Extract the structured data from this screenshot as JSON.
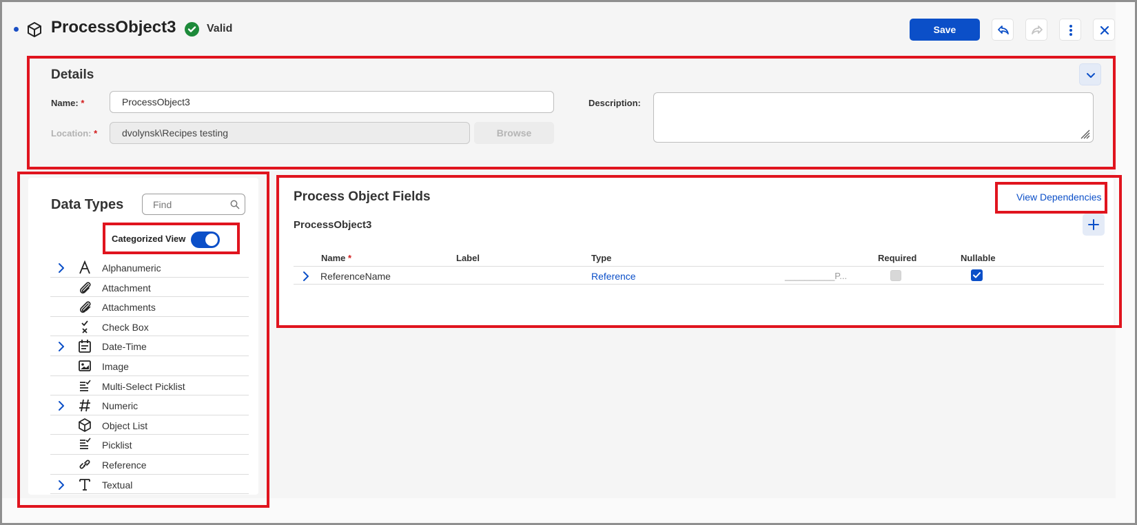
{
  "header": {
    "title": "ProcessObject3",
    "status": "Valid",
    "save_label": "Save"
  },
  "details": {
    "heading": "Details",
    "name_label": "Name:",
    "name_value": "ProcessObject3",
    "location_label": "Location:",
    "location_value": "dvolynsk\\Recipes testing",
    "browse_label": "Browse",
    "description_label": "Description:",
    "required_marker": "*"
  },
  "data_types": {
    "heading": "Data Types",
    "find_placeholder": "Find",
    "categorized_view_label": "Categorized View",
    "categorized_view_on": true,
    "items": [
      {
        "label": "Alphanumeric",
        "icon": "letter-a-icon",
        "expandable": true
      },
      {
        "label": "Attachment",
        "icon": "paperclip-icon",
        "expandable": false
      },
      {
        "label": "Attachments",
        "icon": "paperclips-icon",
        "expandable": false
      },
      {
        "label": "Check Box",
        "icon": "checkbox-icon",
        "expandable": false
      },
      {
        "label": "Date-Time",
        "icon": "calendar-icon",
        "expandable": true
      },
      {
        "label": "Image",
        "icon": "image-icon",
        "expandable": false
      },
      {
        "label": "Multi-Select Picklist",
        "icon": "multi-picklist-icon",
        "expandable": false
      },
      {
        "label": "Numeric",
        "icon": "hash-icon",
        "expandable": true
      },
      {
        "label": "Object List",
        "icon": "cube-icon",
        "expandable": false
      },
      {
        "label": "Picklist",
        "icon": "picklist-icon",
        "expandable": false
      },
      {
        "label": "Reference",
        "icon": "link-icon",
        "expandable": false
      },
      {
        "label": "Textual",
        "icon": "letter-t-icon",
        "expandable": true
      }
    ]
  },
  "fields": {
    "heading": "Process Object Fields",
    "view_dependencies_label": "View Dependencies",
    "object_name": "ProcessObject3",
    "columns": {
      "name": "Name",
      "label": "Label",
      "type": "Type",
      "required": "Required",
      "nullable": "Nullable"
    },
    "rows": [
      {
        "name": "ReferenceName",
        "label": "",
        "type": "Reference",
        "extra": "__________P...",
        "required": false,
        "nullable": true
      }
    ]
  },
  "colors": {
    "accent": "#0b4fc8",
    "valid": "#1d8a3a",
    "highlight": "#e0141e"
  }
}
